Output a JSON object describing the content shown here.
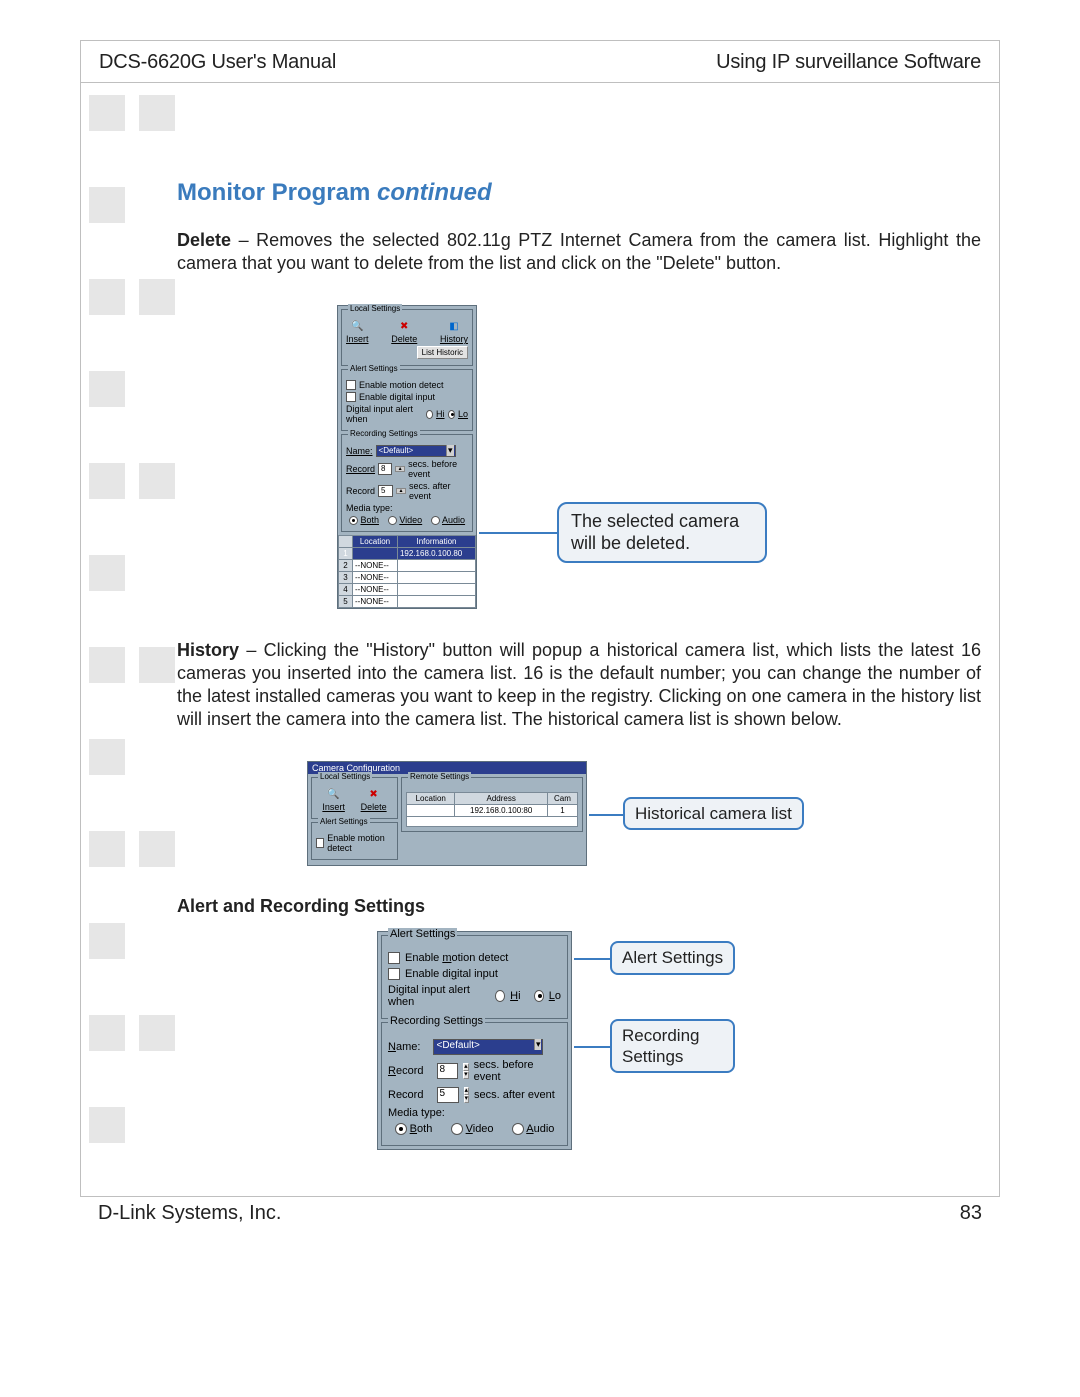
{
  "header": {
    "left": "DCS-6620G User's Manual",
    "right": "Using IP surveillance Software"
  },
  "section": {
    "title_main": "Monitor Program",
    "title_cont": " continued"
  },
  "delete_para": {
    "bold": "Delete",
    "rest": " – Removes the selected 802.11g PTZ Internet Camera from the camera list. Highlight the camera that you want to delete from the list and click  on the \"Delete\" button."
  },
  "fig1": {
    "local_settings": "Local Settings",
    "insert": "Insert",
    "delete": "Delete",
    "history": "History",
    "list_historic": "List Historic",
    "alert_settings": "Alert Settings",
    "enable_motion": "Enable motion detect",
    "enable_digital": "Enable digital input",
    "digital_alert": "Digital input alert when",
    "hi": "Hi",
    "lo": "Lo",
    "recording_settings": "Recording Settings",
    "name": "Name:",
    "default": "<Default>",
    "record1": "Record",
    "record1_val": "8",
    "secs_before": "secs. before event",
    "record2": "Record",
    "record2_val": "5",
    "secs_after": "secs. after event",
    "media_type": "Media type:",
    "both": "Both",
    "video": "Video",
    "audio": "Audio",
    "cols": {
      "location": "Location",
      "information": "Information"
    },
    "rows": [
      {
        "n": "1",
        "loc": "",
        "info": "192.168.0.100.80"
      },
      {
        "n": "2",
        "loc": "--NONE--",
        "info": ""
      },
      {
        "n": "3",
        "loc": "--NONE--",
        "info": ""
      },
      {
        "n": "4",
        "loc": "--NONE--",
        "info": ""
      },
      {
        "n": "5",
        "loc": "--NONE--",
        "info": ""
      }
    ],
    "callout": "The selected camera will be deleted."
  },
  "history_para": {
    "bold": "History",
    "rest": " – Clicking the \"History\" button will popup a historical camera list, which lists the latest 16 cameras you inserted into the camera list. 16 is the default number; you can change the number of the latest installed cameras you want to keep in the registry. Clicking on one camera in the history list will insert the camera into the camera list. The historical camera list is shown below."
  },
  "fig2": {
    "title": "Camera Configuration",
    "local_settings": "Local Settings",
    "remote_settings": "Remote Settings",
    "insert": "Insert",
    "delete": "Delete",
    "alert_settings": "Alert Settings",
    "enable_motion": "Enable motion detect",
    "cols": {
      "location": "Location",
      "address": "Address",
      "cam": "Cam"
    },
    "row": {
      "location": "",
      "address": "192.168.0.100:80",
      "cam": "1"
    },
    "callout": "Historical camera list"
  },
  "subsection": "Alert and Recording Settings",
  "fig3": {
    "alert_settings": "Alert Settings",
    "enable_motion": "Enable motion detect",
    "enable_digital": "Enable digital input",
    "digital_alert": "Digital input alert when",
    "hi": "Hi",
    "lo": "Lo",
    "recording_settings": "Recording Settings",
    "name": "Name:",
    "default": "<Default>",
    "record1": "Record",
    "record1_val": "8",
    "secs_before": "secs. before event",
    "record2": "Record",
    "record2_val": "5",
    "secs_after": "secs. after event",
    "media_type": "Media type:",
    "both": "Both",
    "video": "Video",
    "audio": "Audio",
    "callout_alert": "Alert Settings",
    "callout_recording_1": "Recording",
    "callout_recording_2": "Settings"
  },
  "footer": {
    "left": "D-Link Systems, Inc.",
    "right": "83"
  }
}
